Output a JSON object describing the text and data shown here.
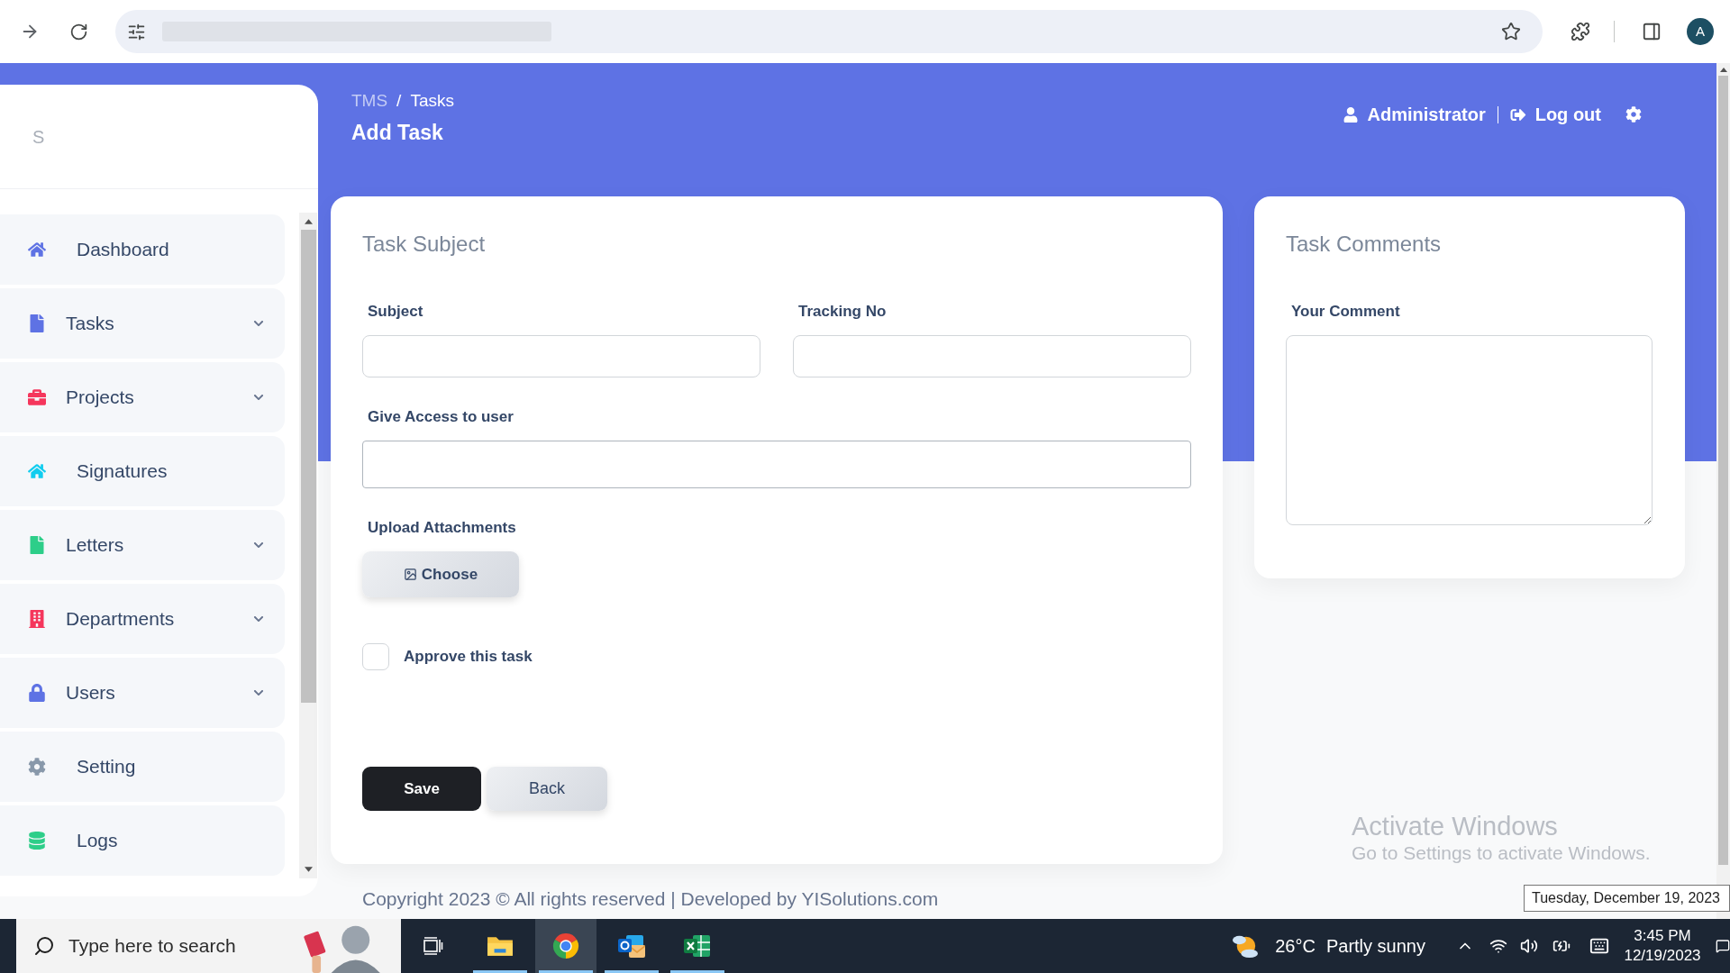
{
  "browser": {
    "profile_initial": "A"
  },
  "header": {
    "breadcrumb": [
      {
        "label": "TMS",
        "selected": false
      },
      {
        "label": "Tasks",
        "selected": true
      }
    ],
    "breadcrumb_separator": "/",
    "title": "Add Task",
    "user": "Administrator",
    "logout": "Log out"
  },
  "sidebar": {
    "logo": "S",
    "items": [
      {
        "label": "Dashboard",
        "color": "#5e72e4",
        "has_submenu": false
      },
      {
        "label": "Tasks",
        "color": "#5e72e4",
        "has_submenu": true
      },
      {
        "label": "Projects",
        "color": "#f5365c",
        "has_submenu": true
      },
      {
        "label": "Signatures",
        "color": "#11cdef",
        "has_submenu": false
      },
      {
        "label": "Letters",
        "color": "#2dce89",
        "has_submenu": true
      },
      {
        "label": "Departments",
        "color": "#f5365c",
        "has_submenu": true
      },
      {
        "label": "Users",
        "color": "#5e72e4",
        "has_submenu": true
      },
      {
        "label": "Setting",
        "color": "#8898aa",
        "has_submenu": false
      },
      {
        "label": "Logs",
        "color": "#2dce89",
        "has_submenu": false
      }
    ]
  },
  "task_subject_card": {
    "title": "Task Subject",
    "fields": [
      {
        "label": "Subject",
        "kind": "text"
      },
      {
        "label": "Tracking No",
        "kind": "text"
      },
      {
        "label": "Give Access to user",
        "kind": "select"
      }
    ],
    "upload": {
      "label": "Upload Attachments",
      "button": "Choose"
    },
    "approve": {
      "label": "Approve this task",
      "checked": false
    },
    "buttons": [
      {
        "label": "Save",
        "kind": "primary"
      },
      {
        "label": "Back",
        "kind": "secondary"
      }
    ]
  },
  "task_comments_card": {
    "title": "Task Comments",
    "field_label": "Your Comment"
  },
  "footer": {
    "copyright": "Copyright 2023 © All rights reserved | Developed by YISolutions.com"
  },
  "windows_activation": {
    "title": "Activate Windows",
    "message": "Go to Settings to activate Windows."
  },
  "taskbar": {
    "search_placeholder": "Type here to search",
    "apps": [
      {
        "running": true,
        "selected": false
      },
      {
        "running": true,
        "selected": true
      },
      {
        "running": true,
        "selected": false
      },
      {
        "running": true,
        "selected": false
      }
    ],
    "weather": {
      "temperature": "26°C",
      "condition": "Partly sunny"
    },
    "clock": {
      "time": "3:45 PM",
      "date": "12/19/2023",
      "tooltip": "Tuesday, December 19, 2023"
    }
  }
}
